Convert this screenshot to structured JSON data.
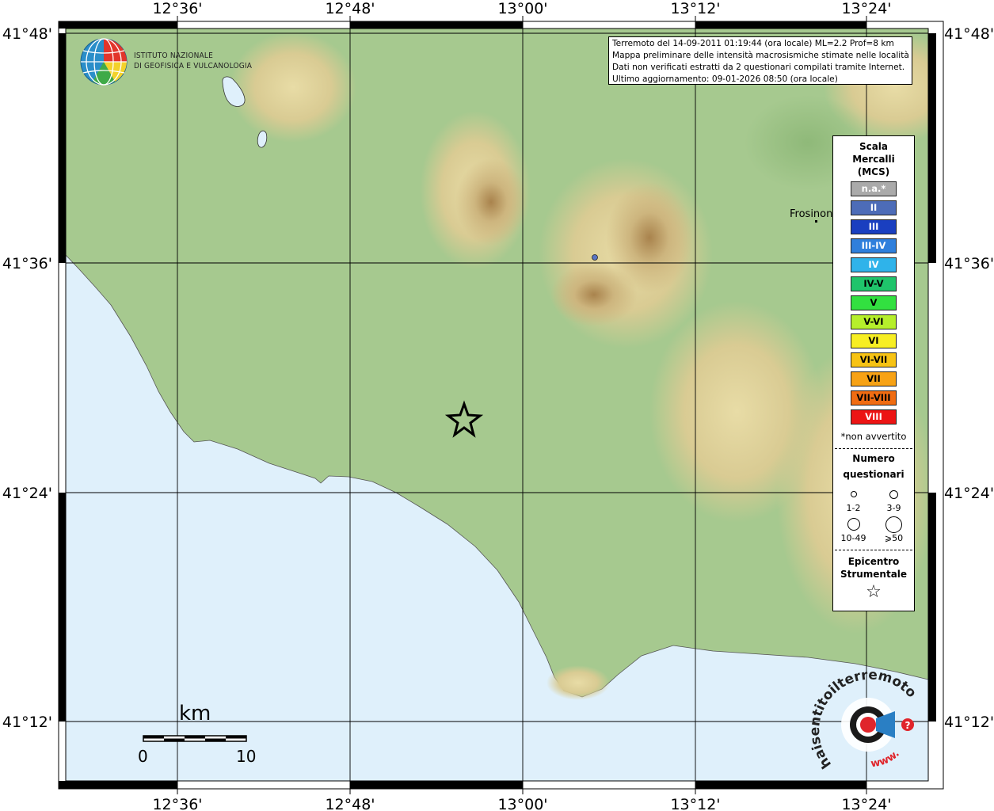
{
  "map": {
    "lon_ticks": [
      "12°36'",
      "12°48'",
      "13°00'",
      "13°12'",
      "13°24'"
    ],
    "lat_ticks_left": [
      "41°48'",
      "41°36'",
      "41°24'",
      "41°12'"
    ],
    "lat_ticks_right": [
      "41°48'",
      "41°36'",
      "41°24'",
      "41°12'"
    ],
    "city": "Frosinone",
    "colors": {
      "sea": "#dff0fb",
      "land": "#a6c98f",
      "relief": "#cdb57e",
      "relief_peak": "#a9834d",
      "dot": "#5874c4"
    }
  },
  "info_box": {
    "line1": "Terremoto del 14-09-2011 01:19:44 (ora locale) ML=2.2 Prof=8 km",
    "line2": "Mappa preliminare delle intensità macrosismiche stimate nelle località",
    "line3": "Dati non verificati estratti da 2 questionari compilati tramite Internet.",
    "line4": "Ultimo aggiornamento: 09-01-2026 08:50 (ora locale)"
  },
  "logo": {
    "line1": "ISTITUTO NAZIONALE",
    "line2": "DI GEOFISICA E VULCANOLOGIA"
  },
  "legend": {
    "title1": "Scala",
    "title2": "Mercalli",
    "title3": "(MCS)",
    "scale": [
      {
        "label": "n.a.*",
        "color": "#aaaaaa",
        "text": "#ffffff"
      },
      {
        "label": "II",
        "color": "#4d6cb8",
        "text": "#ffffff"
      },
      {
        "label": "III",
        "color": "#1a3fc0",
        "text": "#ffffff"
      },
      {
        "label": "III-IV",
        "color": "#2f7fdc",
        "text": "#ffffff"
      },
      {
        "label": "IV",
        "color": "#2fb3ea",
        "text": "#ffffff"
      },
      {
        "label": "IV-V",
        "color": "#1fc46b",
        "text": "#000000"
      },
      {
        "label": "V",
        "color": "#32e040",
        "text": "#000000"
      },
      {
        "label": "V-VI",
        "color": "#b6ef2b",
        "text": "#000000"
      },
      {
        "label": "VI",
        "color": "#f7ee23",
        "text": "#000000"
      },
      {
        "label": "VI-VII",
        "color": "#f7c314",
        "text": "#000000"
      },
      {
        "label": "VII",
        "color": "#f7a215",
        "text": "#000000"
      },
      {
        "label": "VII-VIII",
        "color": "#f06c12",
        "text": "#000000"
      },
      {
        "label": "VIII",
        "color": "#ec1414",
        "text": "#ffffff"
      }
    ],
    "na_note": "*non avvertito",
    "num_title1": "Numero",
    "num_title2": "questionari",
    "circles": [
      {
        "label": "1-2"
      },
      {
        "label": "3-9"
      },
      {
        "label": "10-49"
      },
      {
        "label": "⩾50"
      }
    ],
    "epi_title1": "Epicentro",
    "epi_title2": "Strumentale",
    "epi_icon": "☆"
  },
  "scale_bar": {
    "unit": "km",
    "zero": "0",
    "ten": "10"
  },
  "brand": {
    "text": "haisentitoilterremoto.it",
    "www": "www."
  }
}
